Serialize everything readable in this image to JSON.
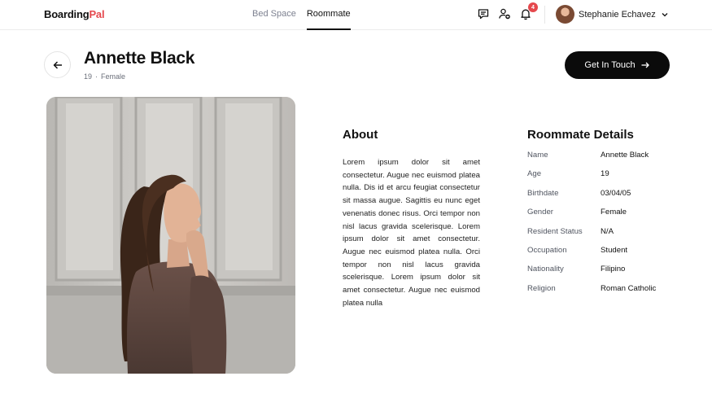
{
  "header": {
    "logo_part1": "Boarding",
    "logo_part2": "Pal",
    "nav": [
      {
        "label": "Bed Space",
        "active": false
      },
      {
        "label": "Roommate",
        "active": true
      }
    ],
    "icons": [
      "chat-icon",
      "user-add-icon",
      "bell-icon"
    ],
    "notification_count": "4",
    "user_name": "Stephanie Echavez"
  },
  "profile": {
    "name": "Annette Black",
    "age": "19",
    "gender": "Female",
    "cta_label": "Get In Touch"
  },
  "about": {
    "title": "About",
    "text": "Lorem ipsum dolor sit amet consectetur. Augue nec euismod platea nulla. Dis id et arcu feugiat consectetur sit massa augue. Sagittis eu nunc eget venenatis donec risus. Orci tempor non nisl lacus gravida scelerisque. Lorem ipsum dolor sit amet consectetur. Augue nec euismod platea nulla. Orci tempor non nisl lacus gravida scelerisque. Lorem ipsum dolor sit amet consectetur. Augue nec euismod platea nulla"
  },
  "details": {
    "title": "Roommate Details",
    "rows": [
      {
        "label": "Name",
        "value": "Annette Black"
      },
      {
        "label": "Age",
        "value": "19"
      },
      {
        "label": "Birthdate",
        "value": "03/04/05"
      },
      {
        "label": "Gender",
        "value": "Female"
      },
      {
        "label": "Resident Status",
        "value": "N/A"
      },
      {
        "label": "Occupation",
        "value": "Student"
      },
      {
        "label": "Nationality",
        "value": "Filipino"
      },
      {
        "label": "Religion",
        "value": "Roman Catholic"
      }
    ]
  },
  "colors": {
    "accent": "#e5484d",
    "cta_bg": "#0b0b0b",
    "muted_text": "#7d8190"
  }
}
